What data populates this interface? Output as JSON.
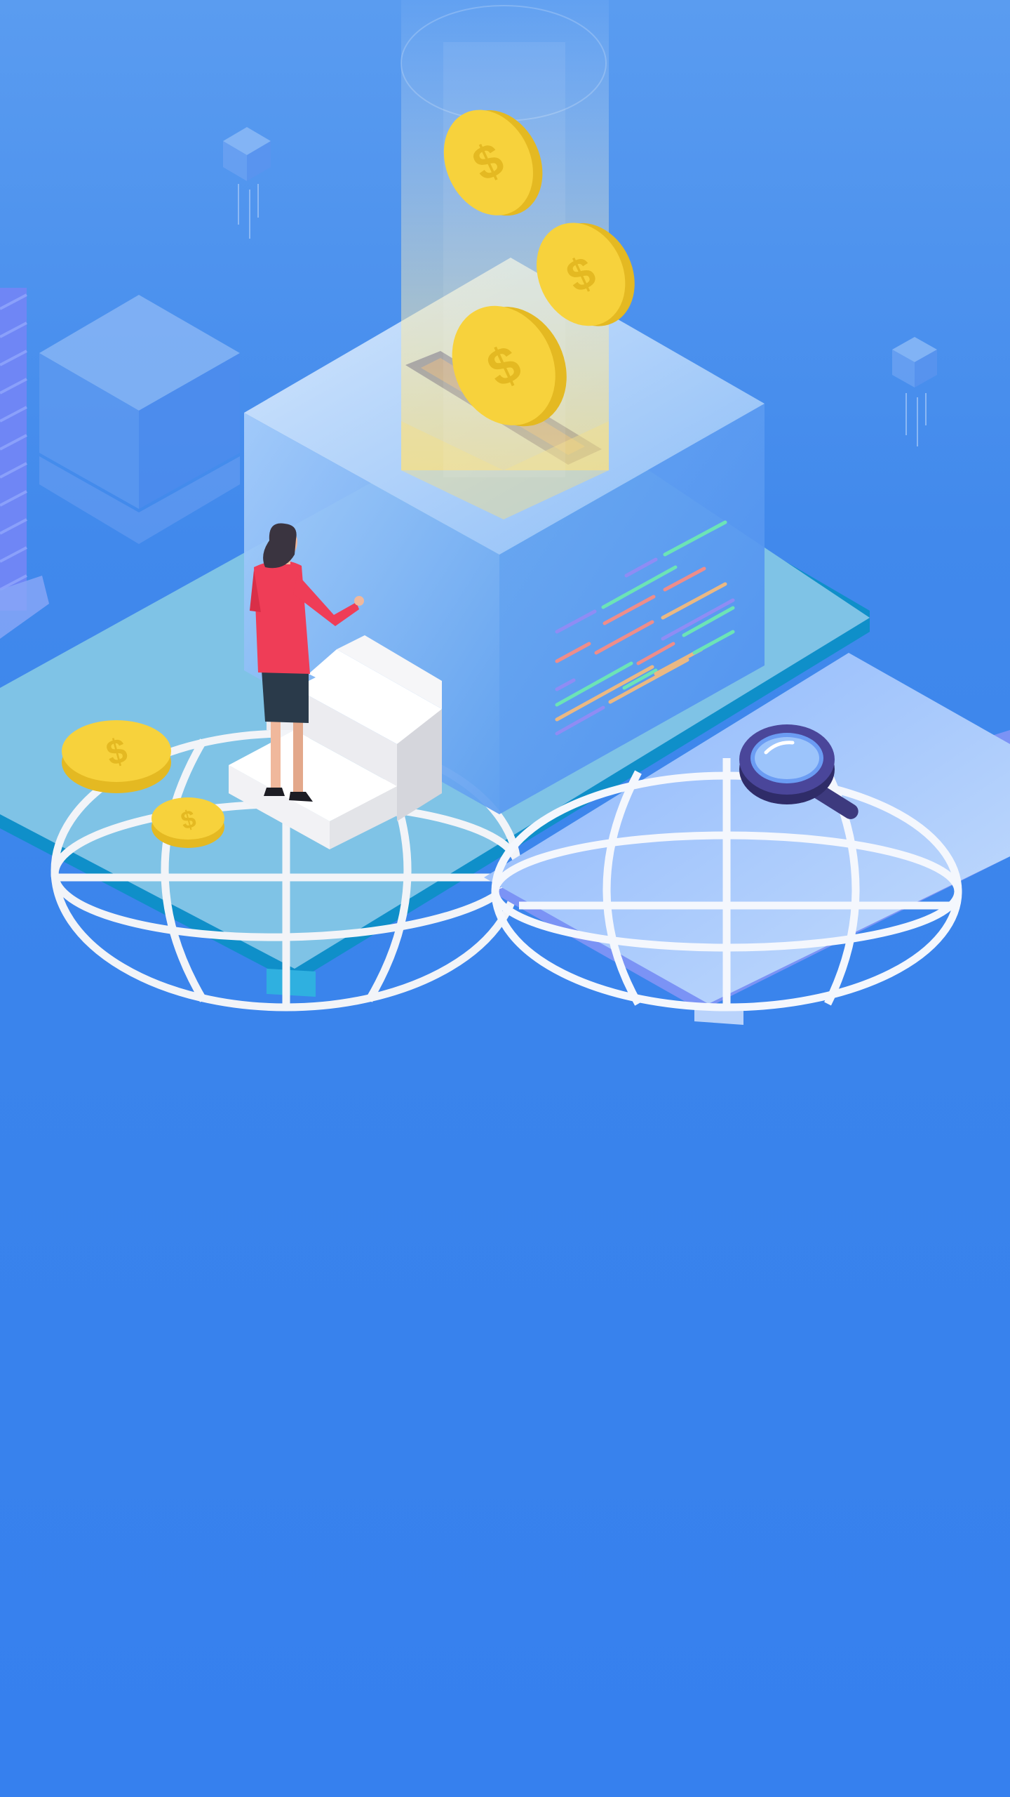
{
  "screen": {
    "name": "splash-illustration",
    "text_content": []
  },
  "illustration": {
    "theme": "isometric finance / investment",
    "colors": {
      "background_top": "#5a9cf0",
      "background_bottom": "#3680ee",
      "coin": "#f7d23c",
      "coin_edge": "#e4b922",
      "person_shirt": "#ef3d57",
      "person_skirt": "#2a3a4a",
      "magnifier": "#3d3a7e",
      "platform_teal": "#7fc3e6",
      "platform_blue": "#a9ccfb"
    },
    "icons": [
      "coin-icon",
      "magnifier-icon",
      "globe-grid-icon",
      "cube-icon",
      "person-figure",
      "stairs-icon"
    ]
  }
}
